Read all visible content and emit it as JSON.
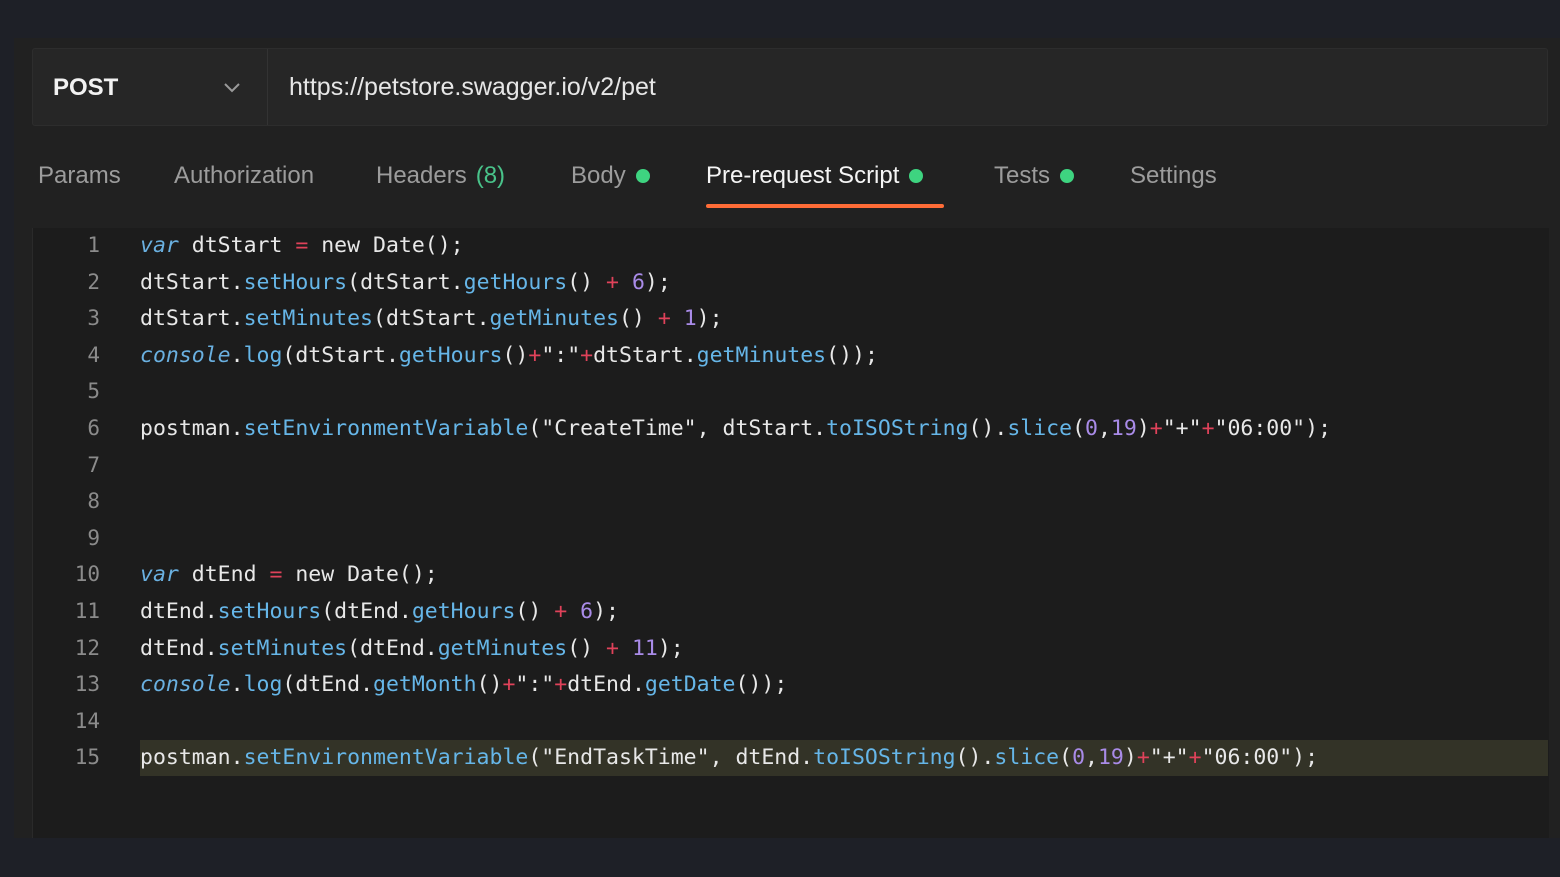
{
  "request": {
    "method": "POST",
    "url": "https://petstore.swagger.io/v2/pet"
  },
  "tabs": [
    {
      "label": "Params"
    },
    {
      "label": "Authorization"
    },
    {
      "label": "Headers",
      "count": "(8)"
    },
    {
      "label": "Body",
      "indicator": true
    },
    {
      "label": "Pre-request Script",
      "indicator": true,
      "active": true
    },
    {
      "label": "Tests",
      "indicator": true
    },
    {
      "label": "Settings"
    }
  ],
  "editor": {
    "line_numbers": [
      "1",
      "2",
      "3",
      "4",
      "5",
      "6",
      "7",
      "8",
      "9",
      "10",
      "11",
      "12",
      "13",
      "14",
      "15"
    ],
    "highlighted_line": "15",
    "lines": [
      "var dtStart = new Date();",
      "dtStart.setHours(dtStart.getHours() + 6);",
      "dtStart.setMinutes(dtStart.getMinutes() + 1);",
      "console.log(dtStart.getHours()+\":\"+dtStart.getMinutes());",
      "",
      "postman.setEnvironmentVariable(\"CreateTime\", dtStart.toISOString().slice(0,19)+\"+\"+\"06:00\");",
      "",
      "",
      "",
      "var dtEnd = new Date();",
      "dtEnd.setHours(dtEnd.getHours() + 6);",
      "dtEnd.setMinutes(dtEnd.getMinutes() + 11);",
      "console.log(dtEnd.getMonth()+\":\"+dtEnd.getDate());",
      "",
      "postman.setEnvironmentVariable(\"EndTaskTime\", dtEnd.toISOString().slice(0,19)+\"+\"+\"06:00\");"
    ]
  },
  "colors": {
    "accent_underline": "#ff6c37",
    "indicator_dot": "#3ed480",
    "keyword": "#6ab0e0",
    "operator": "#e0425a",
    "function": "#66b6e8",
    "number": "#a98be8",
    "class": "#b6d66b"
  },
  "icons": {
    "method_dropdown": "chevron-down-icon"
  }
}
